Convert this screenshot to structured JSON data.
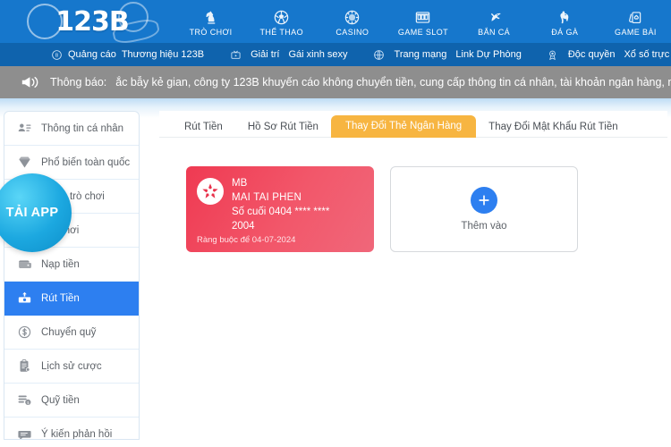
{
  "brand": {
    "logo_text": "123B"
  },
  "main_nav": [
    {
      "label": "TRÒ CHƠI",
      "icon": "chess-knight-icon"
    },
    {
      "label": "THỂ THAO",
      "icon": "soccer-ball-icon"
    },
    {
      "label": "CASINO",
      "icon": "casino-chip-icon"
    },
    {
      "label": "GAME SLOT",
      "icon": "slot-machine-icon"
    },
    {
      "label": "BẮN CÁ",
      "icon": "fish-icon"
    },
    {
      "label": "ĐÁ GÀ",
      "icon": "rooster-icon"
    },
    {
      "label": "GAME BÀI",
      "icon": "playing-cards-icon"
    }
  ],
  "sub_nav": {
    "groups": [
      {
        "icon": "circle-123b-icon",
        "links": [
          "Quảng cáo",
          "Thương hiệu 123B"
        ]
      },
      {
        "icon": "tv-icon",
        "links": [
          "Giải trí",
          "Gái xinh sexy"
        ]
      },
      {
        "icon": "globe-icon",
        "links": [
          "Trang mạng",
          "Link Dự Phòng"
        ]
      },
      {
        "icon": "medal-icon",
        "links": [
          "Độc quyền",
          "Xổ số trực tiếp"
        ]
      }
    ]
  },
  "announcement": {
    "icon": "megaphone-icon",
    "label": "Thông báo:",
    "text": "ắc bẫy kẻ gian, công ty 123B khuyến cáo không chuyển tiền, cung cấp thông tin cá nhân, tài khoản ngân hàng, mật kh"
  },
  "sidebar": {
    "items": [
      {
        "label": "Thông tin cá nhân",
        "icon": "user-card-icon",
        "active": false
      },
      {
        "label": "Phổ biến toàn quốc",
        "icon": "diamond-icon",
        "active": false
      },
      {
        "label": "Mô tả trò chơi",
        "icon": "gamepad-icon",
        "active": false
      },
      {
        "label": "Trò chơi",
        "icon": "play-icon",
        "active": false
      },
      {
        "label": "Nạp tiền",
        "icon": "wallet-icon",
        "active": false
      },
      {
        "label": "Rút Tiền",
        "icon": "withdraw-icon",
        "active": true
      },
      {
        "label": "Chuyển quỹ",
        "icon": "dollar-circle-icon",
        "active": false
      },
      {
        "label": "Lịch sử cược",
        "icon": "clipboard-icon",
        "active": false
      },
      {
        "label": "Quỹ tiền",
        "icon": "coins-icon",
        "active": false
      },
      {
        "label": "Ý kiến phản hồi",
        "icon": "chat-bubble-icon",
        "active": false
      }
    ],
    "floating_button": {
      "label": "TẢI APP"
    }
  },
  "content": {
    "tabs": [
      {
        "label": "Rút Tiền",
        "active": false
      },
      {
        "label": "Hồ Sơ Rút Tiền",
        "active": false
      },
      {
        "label": "Thay Đổi Thẻ Ngân Hàng",
        "active": true
      },
      {
        "label": "Thay Đổi Mật Khẩu Rút Tiền",
        "active": false
      }
    ],
    "bank_card": {
      "logo": "mb-bank-logo-icon",
      "bank_name": "MB",
      "owner_name": "MAI TAI PHEN",
      "card_number_line1": "Số cuối 0404 **** ****",
      "card_number_line2": "2004",
      "binding_text": "Ràng buộc để 04-07-2024"
    },
    "add_card": {
      "icon": "plus-icon",
      "label": "Thêm vào"
    }
  },
  "colors": {
    "header_blue": "#1677cc",
    "subnav_blue": "#0f63ad",
    "announce_gray": "#8e8e8e",
    "accent_orange": "#f7b541",
    "active_blue": "#2d7ff0",
    "card_red": "#ef3a52",
    "bubble_cyan": "#1ca8e0"
  }
}
